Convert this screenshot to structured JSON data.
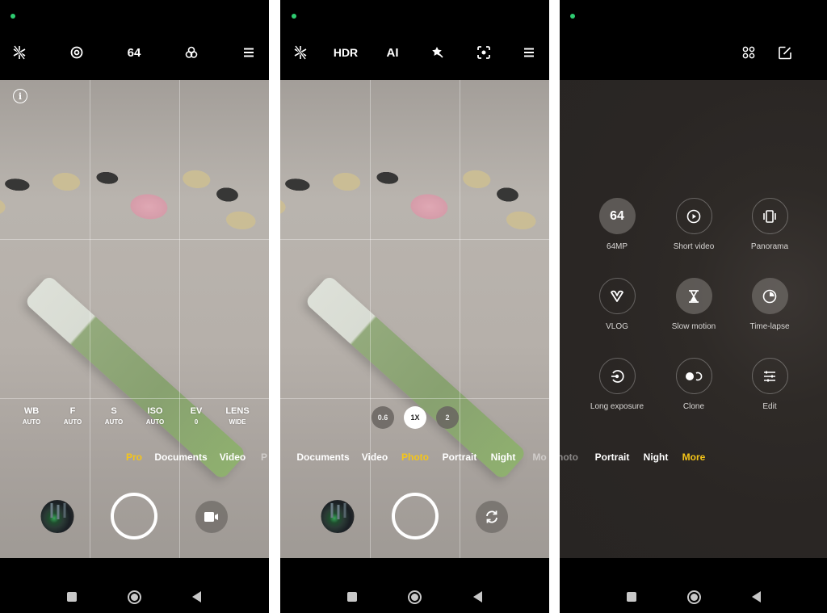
{
  "panels": {
    "pro": {
      "topbar": {
        "flash": "flash-off-icon",
        "focus": "focus-peaking-icon",
        "resolution": "64",
        "filters": "filters-icon",
        "menu": "menu-icon"
      },
      "info": "i",
      "params": [
        {
          "name": "WB",
          "value": "AUTO"
        },
        {
          "name": "F",
          "value": "AUTO"
        },
        {
          "name": "S",
          "value": "AUTO"
        },
        {
          "name": "ISO",
          "value": "AUTO"
        },
        {
          "name": "EV",
          "value": "0"
        },
        {
          "name": "LENS",
          "value": "WIDE"
        }
      ],
      "modes": [
        "Pro",
        "Documents",
        "Video",
        "P"
      ],
      "active_mode": "Pro"
    },
    "photo": {
      "topbar": {
        "flash": "flash-off-icon",
        "hdr": "HDR",
        "ai": "AI",
        "beauty": "magic-wand-icon",
        "lens": "google-lens-icon",
        "menu": "menu-icon"
      },
      "zoom_levels": [
        "0.6",
        "1X",
        "2"
      ],
      "active_zoom": "1X",
      "modes": [
        "Documents",
        "Video",
        "Photo",
        "Portrait",
        "Night",
        "Mo"
      ],
      "active_mode": "Photo"
    },
    "more": {
      "topbar": {
        "grid": "grid-icon",
        "edit": "edit-icon"
      },
      "grid_items": [
        {
          "label": "64MP",
          "icon": "64"
        },
        {
          "label": "Short video",
          "icon": "play-circle-icon"
        },
        {
          "label": "Panorama",
          "icon": "panorama-icon"
        },
        {
          "label": "VLOG",
          "icon": "vlog-icon"
        },
        {
          "label": "Slow motion",
          "icon": "hourglass-icon"
        },
        {
          "label": "Time-lapse",
          "icon": "timer-icon"
        },
        {
          "label": "Long exposure",
          "icon": "long-exposure-icon"
        },
        {
          "label": "Clone",
          "icon": "clone-icon"
        },
        {
          "label": "Edit",
          "icon": "sliders-icon"
        }
      ],
      "modes": [
        "hoto",
        "Portrait",
        "Night",
        "More"
      ],
      "active_mode": "More"
    }
  },
  "colors": {
    "accent": "#f5c518",
    "status_dot": "#2ecc71"
  }
}
